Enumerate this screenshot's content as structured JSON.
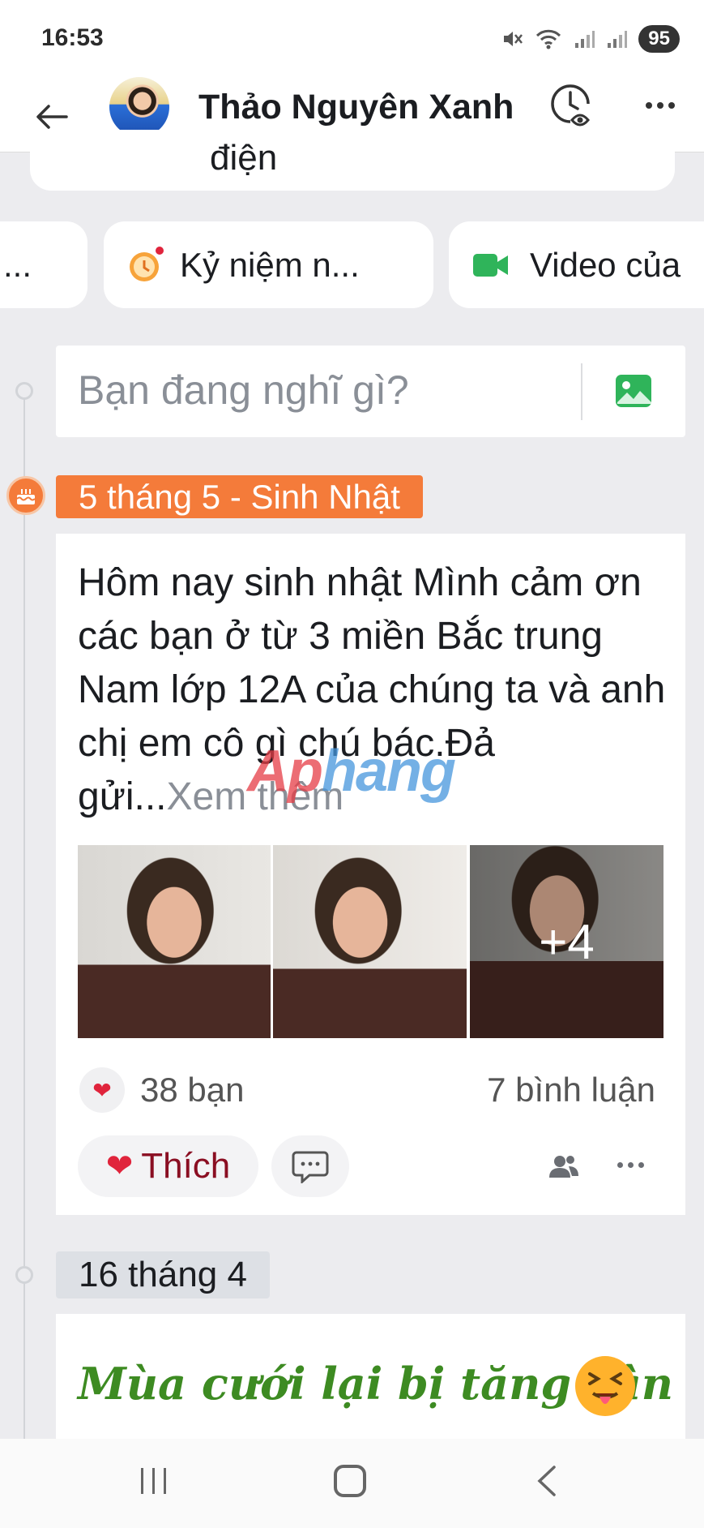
{
  "status_bar": {
    "time": "16:53",
    "battery": "95"
  },
  "header": {
    "profile_name": "Thảo Nguyên Xanh"
  },
  "top_card": {
    "text": "điện"
  },
  "chips": [
    {
      "label": "..."
    },
    {
      "label": "Kỷ niệm n..."
    },
    {
      "label": "Video của"
    }
  ],
  "composer": {
    "placeholder": "Bạn đang nghĩ gì?"
  },
  "timeline": [
    {
      "date_label": "5 tháng 5 - Sinh Nhật",
      "post": {
        "text": "Hôm nay sinh nhật Mình cảm ơn các bạn ở từ 3 miền Bắc trung Nam lớp 12A của chúng ta và anh chị em cô gì chú bác.Đả gửi...",
        "see_more": "Xem thêm",
        "extra_photos": "+4",
        "reactions": "38 bạn",
        "comments": "7 bình luận",
        "like_label": "Thích"
      }
    },
    {
      "date_label": "16 tháng 4",
      "post": {
        "text": "Mùa cưới lại bị tăng cân"
      }
    }
  ],
  "watermark": {
    "part1": "Ap",
    "part2": "hang"
  },
  "colors": {
    "accent_orange": "#f47b3a",
    "like_red": "#e0243c",
    "post_green": "#3d8b22"
  }
}
